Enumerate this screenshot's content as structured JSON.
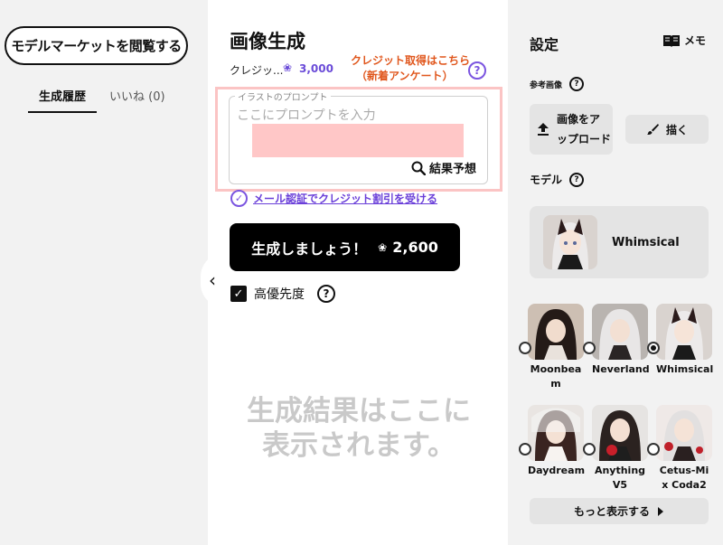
{
  "left": {
    "market_button": "モデルマーケットを閲覧する",
    "tabs": [
      {
        "label": "生成履歴",
        "active": true
      },
      {
        "label": "いいね (0)",
        "active": false
      }
    ]
  },
  "main": {
    "title": "画像生成",
    "credit_label": "クレジッ...",
    "credit_value": "3,000",
    "credit_link_line1": "クレジット取得はこちら",
    "credit_link_line2": "（新着アンケート）",
    "prompt_legend": "イラストのプロンプト",
    "prompt_placeholder": "ここにプロンプトを入力",
    "predict_label": "結果予想",
    "verify_text": "メール認証でクレジット割引を受ける",
    "generate_label": "生成しましょう！",
    "generate_cost": "2,600",
    "priority_label": "高優先度",
    "result_placeholder_line1": "生成結果はここに",
    "result_placeholder_line2": "表示されます。",
    "help_glyph": "?",
    "collapse_glyph": "‹"
  },
  "settings": {
    "title": "設定",
    "memo_label": "メモ",
    "reference_label": "参考画像",
    "upload_line1": "画像をア",
    "upload_line2": "ップロード",
    "draw_label": "描く",
    "model_label": "モデル",
    "selected_model": "Whimsical",
    "models": [
      {
        "name": "Moonbea m",
        "line1": "Moonbea",
        "line2": "m",
        "selected": false
      },
      {
        "name": "Neverland",
        "line1": "Neverland",
        "line2": "",
        "selected": false
      },
      {
        "name": "Whimsical",
        "line1": "Whimsical",
        "line2": "",
        "selected": true
      },
      {
        "name": "Daydream",
        "line1": "Daydream",
        "line2": "",
        "selected": false
      },
      {
        "name": "Anything V5",
        "line1": "Anything",
        "line2": "V5",
        "selected": false
      },
      {
        "name": "Cetus-Mix Coda2",
        "line1": "Cetus-Mi",
        "line2": "x Coda2",
        "selected": false
      }
    ],
    "more_label": "もっと表示する"
  },
  "colors": {
    "accent_purple": "#7b55e0",
    "link_orange": "#e0561c",
    "highlight_pink": "#fbc4c4"
  }
}
